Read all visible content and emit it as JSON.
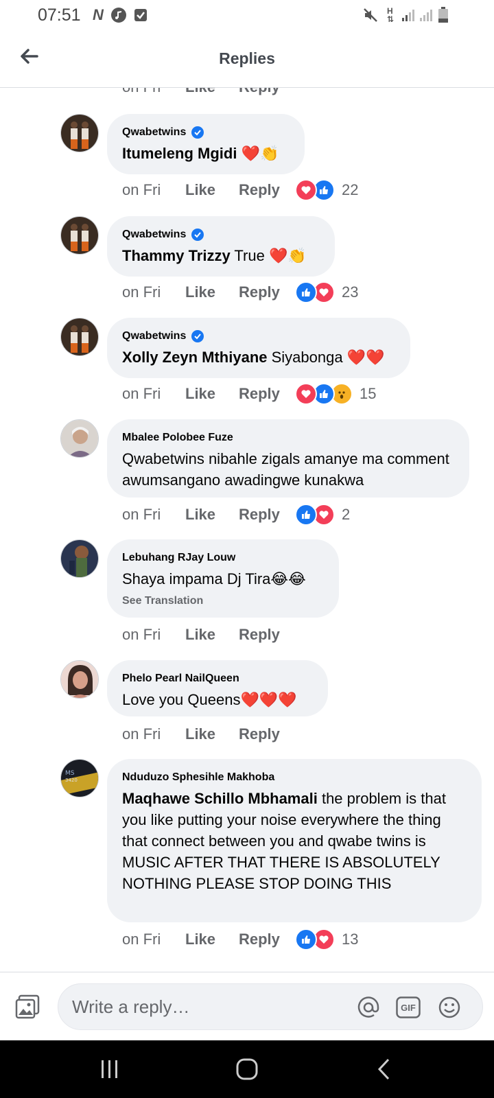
{
  "status_bar": {
    "time": "07:51",
    "icons": [
      "n-app-icon",
      "music-icon",
      "checkbox-icon",
      "mute-icon",
      "data-arrows-icon",
      "signal-icon",
      "signal-icon",
      "battery-icon"
    ]
  },
  "header": {
    "title": "Replies"
  },
  "partial_row": {
    "time": "on Fri",
    "like": "Like",
    "reply": "Reply"
  },
  "comments": [
    {
      "author": "Qwabetwins",
      "verified": true,
      "mention": "Itumeleng Mgidi",
      "text": " ❤️👏",
      "time": "on Fri",
      "like": "Like",
      "reply": "Reply",
      "reactions": [
        "love",
        "like"
      ],
      "count": "22"
    },
    {
      "author": "Qwabetwins",
      "verified": true,
      "mention": "Thammy Trizzy",
      "text": " True ❤️👏",
      "time": "on Fri",
      "like": "Like",
      "reply": "Reply",
      "reactions": [
        "like",
        "love"
      ],
      "count": "23"
    },
    {
      "author": "Qwabetwins",
      "verified": true,
      "mention": "Xolly Zeyn Mthiyane",
      "text": " Siyabonga ❤️❤️",
      "time": "on Fri",
      "like": "Like",
      "reply": "Reply",
      "reactions": [
        "love",
        "like",
        "wow"
      ],
      "count": "15"
    },
    {
      "author": "Mbalee Polobee Fuze",
      "text": "Qwabetwins nibahle zigals amanye ma comment awumsangano awadingwe kunakwa",
      "time": "on Fri",
      "like": "Like",
      "reply": "Reply",
      "reactions": [
        "like",
        "love"
      ],
      "count": "2"
    },
    {
      "author": "Lebuhang RJay Louw",
      "text": "Shaya impama Dj Tira😂😂",
      "see_translation": "See Translation",
      "time": "on Fri",
      "like": "Like",
      "reply": "Reply"
    },
    {
      "author": "Phelo Pearl NailQueen",
      "text": "Love you Queens❤️❤️❤️",
      "time": "on Fri",
      "like": "Like",
      "reply": "Reply"
    },
    {
      "author": "Nduduzo Sphesihle Makhoba",
      "mention": "Maqhawe Schillo Mbhamali",
      "text": " the problem  is that you like putting  your noise everywhere the thing that connect between you and qwabe twins is MUSIC AFTER THAT THERE IS ABSOLUTELY  NOTHING PLEASE  STOP DOING THIS",
      "time": "on Fri",
      "like": "Like",
      "reply": "Reply",
      "reactions": [
        "like",
        "love"
      ],
      "count": "13"
    }
  ],
  "composer": {
    "placeholder": "Write a reply…",
    "gif_label": "GIF"
  },
  "colors": {
    "accent": "#1877f2",
    "love": "#f33e58",
    "bubble": "#f0f2f5",
    "meta_text": "#65676b"
  }
}
